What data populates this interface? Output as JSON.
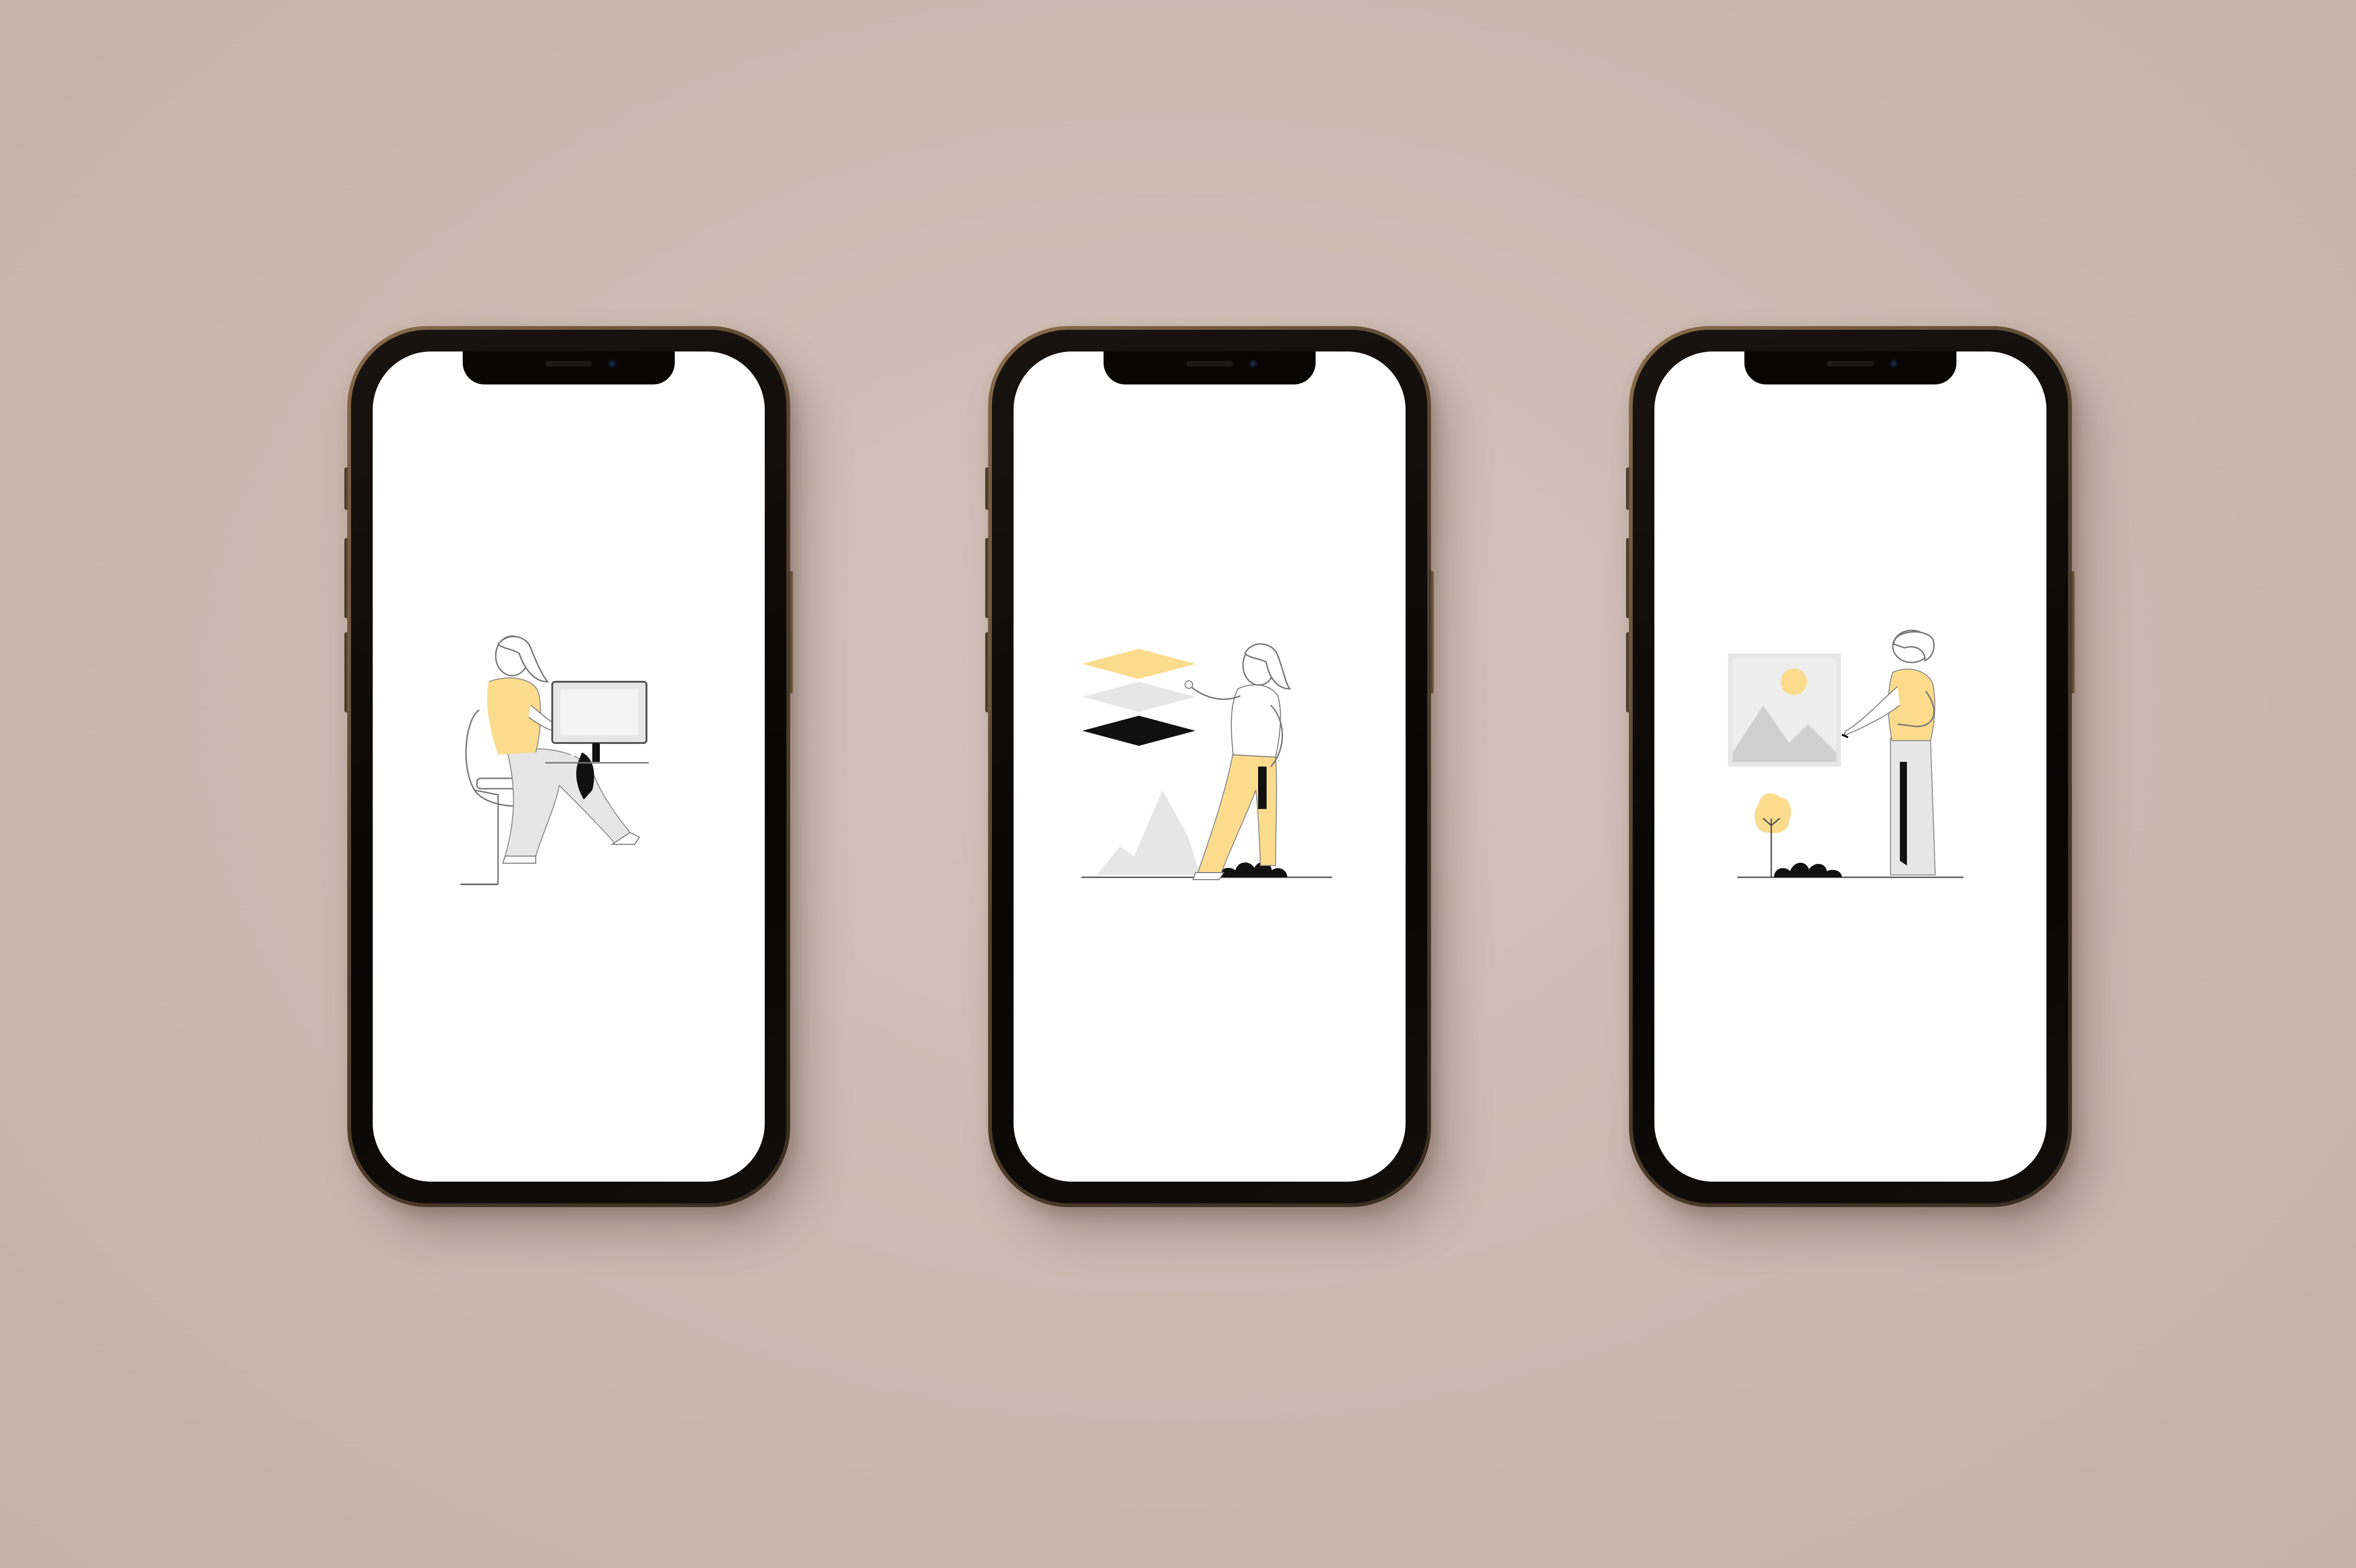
{
  "background_color": "#cdb8b0",
  "accent_color": "#fbdb8c",
  "neutral_color": "#e6e6e6",
  "ink_color": "#111111",
  "phones": [
    {
      "illustration": "person-at-desk-icon"
    },
    {
      "illustration": "person-with-layers-icon"
    },
    {
      "illustration": "person-with-picture-icon"
    }
  ]
}
